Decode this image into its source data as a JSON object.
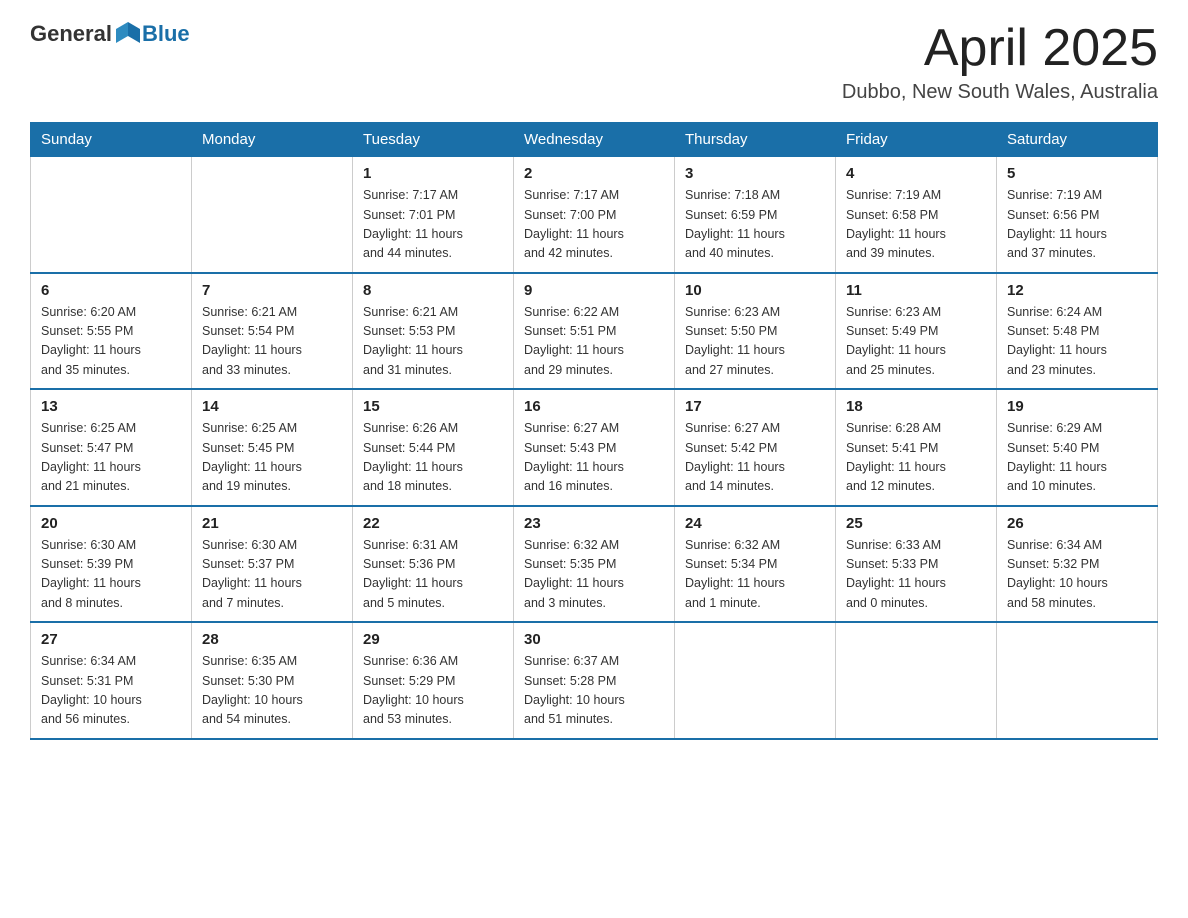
{
  "header": {
    "logo_general": "General",
    "logo_blue": "Blue",
    "month_title": "April 2025",
    "location": "Dubbo, New South Wales, Australia"
  },
  "days_of_week": [
    "Sunday",
    "Monday",
    "Tuesday",
    "Wednesday",
    "Thursday",
    "Friday",
    "Saturday"
  ],
  "weeks": [
    [
      {
        "num": "",
        "info": ""
      },
      {
        "num": "",
        "info": ""
      },
      {
        "num": "1",
        "info": "Sunrise: 7:17 AM\nSunset: 7:01 PM\nDaylight: 11 hours\nand 44 minutes."
      },
      {
        "num": "2",
        "info": "Sunrise: 7:17 AM\nSunset: 7:00 PM\nDaylight: 11 hours\nand 42 minutes."
      },
      {
        "num": "3",
        "info": "Sunrise: 7:18 AM\nSunset: 6:59 PM\nDaylight: 11 hours\nand 40 minutes."
      },
      {
        "num": "4",
        "info": "Sunrise: 7:19 AM\nSunset: 6:58 PM\nDaylight: 11 hours\nand 39 minutes."
      },
      {
        "num": "5",
        "info": "Sunrise: 7:19 AM\nSunset: 6:56 PM\nDaylight: 11 hours\nand 37 minutes."
      }
    ],
    [
      {
        "num": "6",
        "info": "Sunrise: 6:20 AM\nSunset: 5:55 PM\nDaylight: 11 hours\nand 35 minutes."
      },
      {
        "num": "7",
        "info": "Sunrise: 6:21 AM\nSunset: 5:54 PM\nDaylight: 11 hours\nand 33 minutes."
      },
      {
        "num": "8",
        "info": "Sunrise: 6:21 AM\nSunset: 5:53 PM\nDaylight: 11 hours\nand 31 minutes."
      },
      {
        "num": "9",
        "info": "Sunrise: 6:22 AM\nSunset: 5:51 PM\nDaylight: 11 hours\nand 29 minutes."
      },
      {
        "num": "10",
        "info": "Sunrise: 6:23 AM\nSunset: 5:50 PM\nDaylight: 11 hours\nand 27 minutes."
      },
      {
        "num": "11",
        "info": "Sunrise: 6:23 AM\nSunset: 5:49 PM\nDaylight: 11 hours\nand 25 minutes."
      },
      {
        "num": "12",
        "info": "Sunrise: 6:24 AM\nSunset: 5:48 PM\nDaylight: 11 hours\nand 23 minutes."
      }
    ],
    [
      {
        "num": "13",
        "info": "Sunrise: 6:25 AM\nSunset: 5:47 PM\nDaylight: 11 hours\nand 21 minutes."
      },
      {
        "num": "14",
        "info": "Sunrise: 6:25 AM\nSunset: 5:45 PM\nDaylight: 11 hours\nand 19 minutes."
      },
      {
        "num": "15",
        "info": "Sunrise: 6:26 AM\nSunset: 5:44 PM\nDaylight: 11 hours\nand 18 minutes."
      },
      {
        "num": "16",
        "info": "Sunrise: 6:27 AM\nSunset: 5:43 PM\nDaylight: 11 hours\nand 16 minutes."
      },
      {
        "num": "17",
        "info": "Sunrise: 6:27 AM\nSunset: 5:42 PM\nDaylight: 11 hours\nand 14 minutes."
      },
      {
        "num": "18",
        "info": "Sunrise: 6:28 AM\nSunset: 5:41 PM\nDaylight: 11 hours\nand 12 minutes."
      },
      {
        "num": "19",
        "info": "Sunrise: 6:29 AM\nSunset: 5:40 PM\nDaylight: 11 hours\nand 10 minutes."
      }
    ],
    [
      {
        "num": "20",
        "info": "Sunrise: 6:30 AM\nSunset: 5:39 PM\nDaylight: 11 hours\nand 8 minutes."
      },
      {
        "num": "21",
        "info": "Sunrise: 6:30 AM\nSunset: 5:37 PM\nDaylight: 11 hours\nand 7 minutes."
      },
      {
        "num": "22",
        "info": "Sunrise: 6:31 AM\nSunset: 5:36 PM\nDaylight: 11 hours\nand 5 minutes."
      },
      {
        "num": "23",
        "info": "Sunrise: 6:32 AM\nSunset: 5:35 PM\nDaylight: 11 hours\nand 3 minutes."
      },
      {
        "num": "24",
        "info": "Sunrise: 6:32 AM\nSunset: 5:34 PM\nDaylight: 11 hours\nand 1 minute."
      },
      {
        "num": "25",
        "info": "Sunrise: 6:33 AM\nSunset: 5:33 PM\nDaylight: 11 hours\nand 0 minutes."
      },
      {
        "num": "26",
        "info": "Sunrise: 6:34 AM\nSunset: 5:32 PM\nDaylight: 10 hours\nand 58 minutes."
      }
    ],
    [
      {
        "num": "27",
        "info": "Sunrise: 6:34 AM\nSunset: 5:31 PM\nDaylight: 10 hours\nand 56 minutes."
      },
      {
        "num": "28",
        "info": "Sunrise: 6:35 AM\nSunset: 5:30 PM\nDaylight: 10 hours\nand 54 minutes."
      },
      {
        "num": "29",
        "info": "Sunrise: 6:36 AM\nSunset: 5:29 PM\nDaylight: 10 hours\nand 53 minutes."
      },
      {
        "num": "30",
        "info": "Sunrise: 6:37 AM\nSunset: 5:28 PM\nDaylight: 10 hours\nand 51 minutes."
      },
      {
        "num": "",
        "info": ""
      },
      {
        "num": "",
        "info": ""
      },
      {
        "num": "",
        "info": ""
      }
    ]
  ]
}
